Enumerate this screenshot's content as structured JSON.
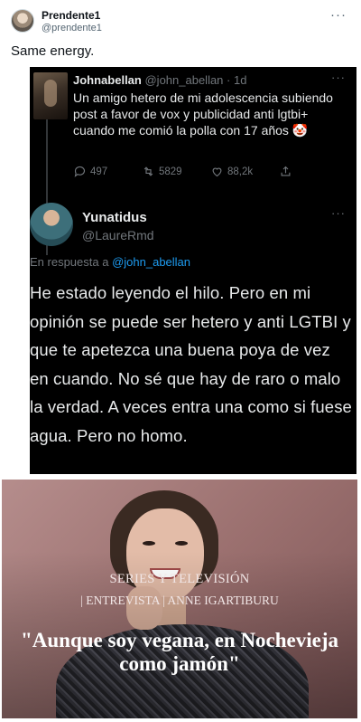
{
  "outer_tweet": {
    "name": "Prendente1",
    "handle": "@prendente1",
    "more_icon": "more-dots-icon",
    "more_label": "···",
    "text": "Same energy."
  },
  "screenshot_tweet_1": {
    "name": "Johnabellan",
    "handle": "@john_abellan",
    "time": "· 1d",
    "more_label": "···",
    "text": "Un amigo hetero de mi adolescencia subiendo post a favor de vox y publicidad anti lgtbi+ cuando me comió la polla con 17 años 🤡",
    "replies": "497",
    "retweets": "5829",
    "likes": "88,2k"
  },
  "screenshot_tweet_2": {
    "name": "Yunatidus",
    "handle": "@LaureRmd",
    "more_label": "···",
    "reply_prefix": "En respuesta a",
    "reply_mention": "@john_abellan",
    "text": "He estado leyendo el hilo. Pero en mi opinión se puede ser hetero y anti LGTBI y que te apetezca una buena poya de vez en cuando. No sé que hay de raro o malo la verdad. A veces entra una como si fuese agua. Pero no homo."
  },
  "magazine": {
    "section": "SERIES Y TELEVISIÓN",
    "subtitle": "| ENTREVISTA | ANNE IGARTIBURU",
    "quote": "\"Aunque soy vegana, en Nochevieja como jamón\""
  },
  "colors": {
    "dark_bg": "#000000",
    "muted": "#71767b",
    "link": "#1d9bf0",
    "magazine_bg": "#9b706f"
  }
}
